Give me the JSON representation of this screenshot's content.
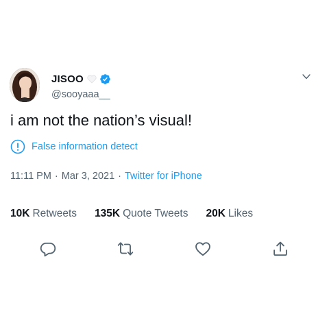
{
  "user": {
    "display_name": "JISOO",
    "handle": "@sooyaaa__",
    "verified": true,
    "name_emoji": "white-heart-icon"
  },
  "tweet": {
    "text": "i am not the nation’s visual!",
    "notice": "False information detect",
    "time": "11:11 PM",
    "date": "Mar 3, 2021",
    "separator": "·",
    "source": "Twitter for iPhone"
  },
  "stats": [
    {
      "value": "10K",
      "label": "Retweets"
    },
    {
      "value": "135K",
      "label": "Quote Tweets"
    },
    {
      "value": "20K",
      "label": "Likes"
    }
  ],
  "actions": [
    "reply-icon",
    "retweet-icon",
    "like-icon",
    "share-icon"
  ],
  "colors": {
    "accent": "#1d9bf0",
    "text": "#0f1419",
    "secondary": "#536471",
    "icon": "#536471"
  }
}
